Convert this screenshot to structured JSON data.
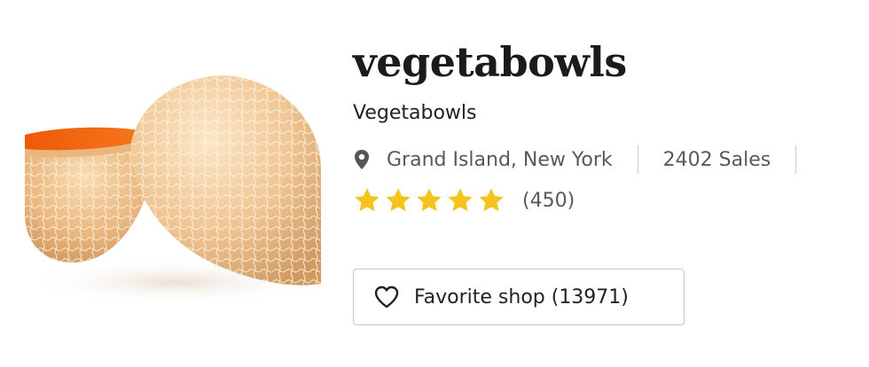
{
  "shop": {
    "name": "vegetabowls",
    "title": "Vegetabowls",
    "location": "Grand Island, New York",
    "sales": "2402 Sales",
    "rating": 5,
    "rating_max": 5,
    "reviews": "(450)",
    "favorite_label": "Favorite shop (13971)"
  },
  "icons": {
    "location": "map-pin-icon",
    "rating": "star-icon",
    "favorite": "heart-outline-icon"
  },
  "colors": {
    "star": "#f6c31c",
    "text_primary": "#222222",
    "text_secondary": "#595959",
    "button_border": "#c8c8c8"
  }
}
